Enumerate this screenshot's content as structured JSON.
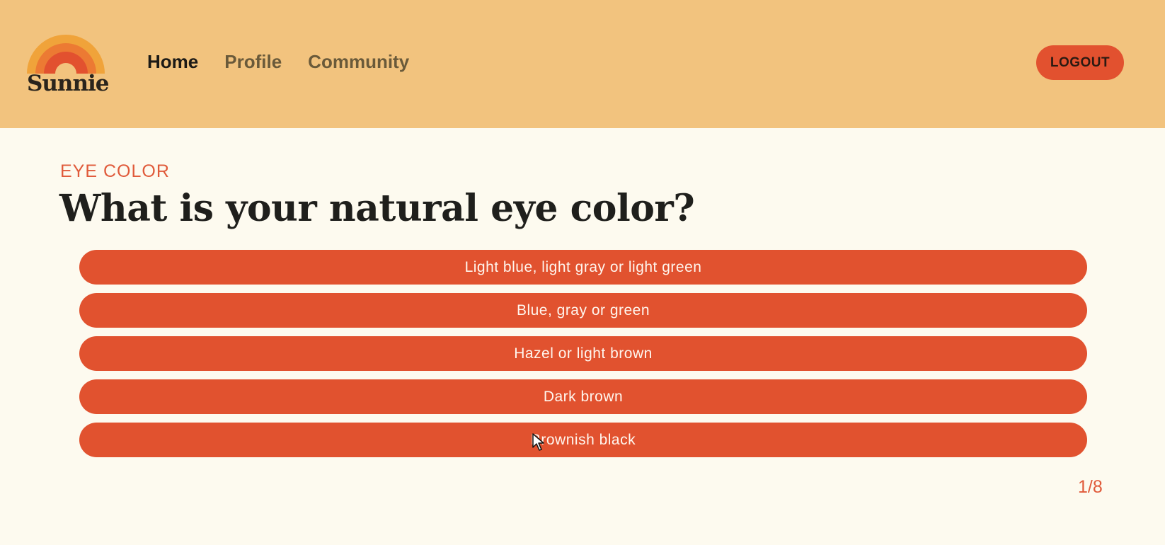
{
  "header": {
    "brand": "Sunnie",
    "nav": [
      {
        "label": "Home"
      },
      {
        "label": "Profile"
      },
      {
        "label": "Community"
      }
    ],
    "logout_label": "LOGOUT",
    "background": "#f2c37e"
  },
  "quiz": {
    "category": "EYE COLOR",
    "question": "What is your natural eye color?",
    "options": [
      {
        "label": "Light blue, light gray or light green"
      },
      {
        "label": "Blue, gray or green"
      },
      {
        "label": "Hazel or light brown"
      },
      {
        "label": "Dark brown"
      },
      {
        "label": "Brownish black"
      }
    ],
    "progress": "1/8"
  },
  "colors": {
    "accent": "#e1522f",
    "page_background": "#fdfaef"
  },
  "icons": {
    "logo": "rainbow-sun-icon",
    "cursor": "mouse-pointer-icon"
  }
}
